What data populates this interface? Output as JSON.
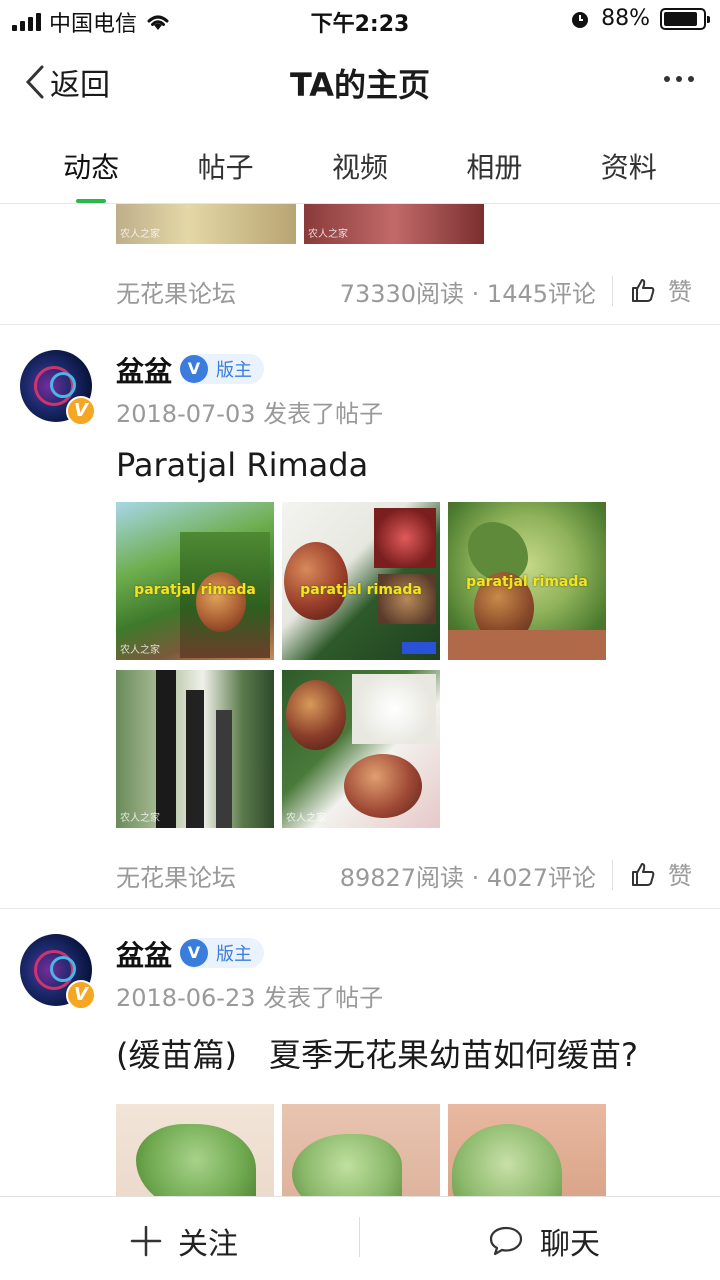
{
  "status_bar": {
    "carrier": "中国电信",
    "time": "下午2:23",
    "battery": "88%",
    "battery_level": 0.88
  },
  "nav": {
    "back_label": "返回",
    "title": "TA的主页"
  },
  "tabs": [
    {
      "label": "动态",
      "active": true
    },
    {
      "label": "帖子",
      "active": false
    },
    {
      "label": "视频",
      "active": false
    },
    {
      "label": "相册",
      "active": false
    },
    {
      "label": "资料",
      "active": false
    }
  ],
  "prev_post": {
    "forum": "无花果论坛",
    "stats": "73330阅读 · 1445评论",
    "like_label": "赞"
  },
  "posts": [
    {
      "author": "盆盆",
      "role": "版主",
      "badge": "V",
      "meta": "2018-07-03 发表了帖子",
      "title": "Paratjal Rimada",
      "forum": "无花果论坛",
      "stats": "89827阅读 · 4027评论",
      "like_label": "赞",
      "image_label_left": "paratjal",
      "image_label_right": "rimada",
      "watermark": "农人之家"
    },
    {
      "author": "盆盆",
      "role": "版主",
      "badge": "V",
      "meta": "2018-06-23 发表了帖子",
      "title": "(缓苗篇)　夏季无花果幼苗如何缓苗?"
    }
  ],
  "bottom": {
    "follow_label": "关注",
    "chat_label": "聊天"
  }
}
